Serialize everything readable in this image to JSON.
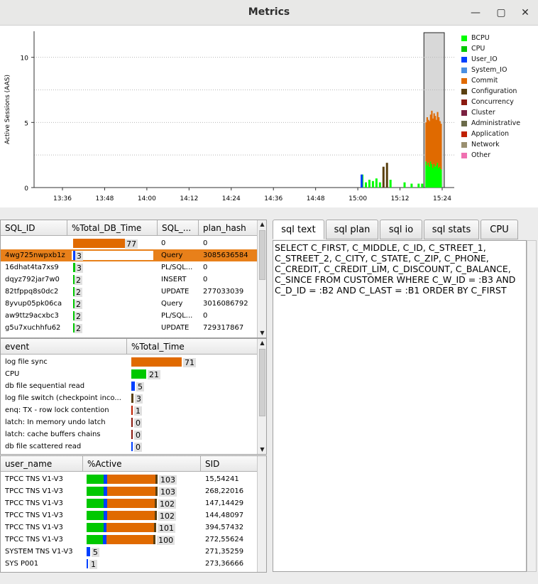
{
  "window": {
    "title": "Metrics"
  },
  "chart_data": {
    "type": "area",
    "ylabel": "Active Sessions (AAS)",
    "yticks": [
      0,
      5,
      10
    ],
    "xticks": [
      "13:36",
      "13:48",
      "14:00",
      "14:12",
      "14:24",
      "14:36",
      "14:48",
      "15:00",
      "15:12",
      "15:24"
    ],
    "ylim": [
      0,
      12
    ],
    "grid": true,
    "legend_placement": "right",
    "legend": [
      {
        "name": "BCPU",
        "color": "#00ff00"
      },
      {
        "name": "CPU",
        "color": "#00c800"
      },
      {
        "name": "User_IO",
        "color": "#0040ff"
      },
      {
        "name": "System_IO",
        "color": "#4a90e2"
      },
      {
        "name": "Commit",
        "color": "#e06a00"
      },
      {
        "name": "Configuration",
        "color": "#5a4010"
      },
      {
        "name": "Concurrency",
        "color": "#8b1a10"
      },
      {
        "name": "Cluster",
        "color": "#7a2040"
      },
      {
        "name": "Administrative",
        "color": "#6b6b4a"
      },
      {
        "name": "Application",
        "color": "#c02000"
      },
      {
        "name": "Network",
        "color": "#9a9070"
      },
      {
        "name": "Other",
        "color": "#f070b0"
      }
    ],
    "selection_window": [
      "15:19",
      "15:24"
    ]
  },
  "sql_table": {
    "headers": [
      "SQL_ID",
      "%Total_DB_Time",
      "SQL_...",
      "plan_hash"
    ],
    "rows": [
      {
        "id": "",
        "pct": "77",
        "type": "0",
        "hash": "0",
        "pctv": 77
      },
      {
        "id": "4wg725nwpxb1z",
        "pct": "3",
        "type": "Query",
        "hash": "3085636584",
        "pctv": 3,
        "selected": true
      },
      {
        "id": "16dhat4ta7xs9",
        "pct": "3",
        "type": "PL/SQL...",
        "hash": "0",
        "pctv": 3
      },
      {
        "id": "dqyz792jar7w0",
        "pct": "2",
        "type": "INSERT",
        "hash": "0",
        "pctv": 2
      },
      {
        "id": "82tfppq8s0dc2",
        "pct": "2",
        "type": "UPDATE",
        "hash": "277033039",
        "pctv": 2
      },
      {
        "id": "8yvup05pk06ca",
        "pct": "2",
        "type": "Query",
        "hash": "3016086792",
        "pctv": 2
      },
      {
        "id": "aw9ttz9acxbc3",
        "pct": "2",
        "type": "PL/SQL...",
        "hash": "0",
        "pctv": 2
      },
      {
        "id": "g5u7xuchhfu62",
        "pct": "2",
        "type": "UPDATE",
        "hash": "729317867",
        "pctv": 2
      }
    ]
  },
  "event_table": {
    "headers": [
      "event",
      "%Total_Time"
    ],
    "rows": [
      {
        "name": "log file sync",
        "pct": "71",
        "pctv": 71,
        "color": "#e06a00"
      },
      {
        "name": "CPU",
        "pct": "21",
        "pctv": 21,
        "color": "#00c800"
      },
      {
        "name": "db file sequential read",
        "pct": "5",
        "pctv": 5,
        "color": "#0040ff"
      },
      {
        "name": "log file switch (checkpoint inco...",
        "pct": "3",
        "pctv": 3,
        "color": "#5a4010"
      },
      {
        "name": "enq: TX - row lock contention",
        "pct": "1",
        "pctv": 1,
        "color": "#c02000"
      },
      {
        "name": "latch: In memory undo latch",
        "pct": "0",
        "pctv": 0,
        "color": "#8b1a10"
      },
      {
        "name": "latch: cache buffers chains",
        "pct": "0",
        "pctv": 0,
        "color": "#8b1a10"
      },
      {
        "name": "db file scattered read",
        "pct": "0",
        "pctv": 0,
        "color": "#0040ff"
      }
    ]
  },
  "session_table": {
    "headers": [
      "user_name",
      "%Active",
      "SID"
    ],
    "rows": [
      {
        "user": "TPCC TNS V1-V3",
        "pct": "103",
        "pctv": 103,
        "sid": "15,54241"
      },
      {
        "user": "TPCC TNS V1-V3",
        "pct": "103",
        "pctv": 103,
        "sid": "268,22016"
      },
      {
        "user": "TPCC TNS V1-V3",
        "pct": "102",
        "pctv": 102,
        "sid": "147,14429"
      },
      {
        "user": "TPCC TNS V1-V3",
        "pct": "102",
        "pctv": 102,
        "sid": "144,48097"
      },
      {
        "user": "TPCC TNS V1-V3",
        "pct": "101",
        "pctv": 101,
        "sid": "394,57432"
      },
      {
        "user": "TPCC TNS V1-V3",
        "pct": "100",
        "pctv": 100,
        "sid": "272,55624"
      },
      {
        "user": "SYSTEM TNS V1-V3",
        "pct": "5",
        "pctv": 5,
        "sid": "271,35259"
      },
      {
        "user": "SYS P001",
        "pct": "1",
        "pctv": 1,
        "sid": "273,36666"
      }
    ]
  },
  "tabs": [
    "sql text",
    "sql plan",
    "sql io",
    "sql stats",
    "CPU"
  ],
  "sql_text": "SELECT C_FIRST, C_MIDDLE, C_ID, C_STREET_1, C_STREET_2, C_CITY, C_STATE, C_ZIP, C_PHONE, C_CREDIT, C_CREDIT_LIM, C_DISCOUNT, C_BALANCE, C_SINCE FROM CUSTOMER WHERE C_W_ID = :B3 AND C_D_ID = :B2 AND C_LAST = :B1 ORDER BY C_FIRST"
}
